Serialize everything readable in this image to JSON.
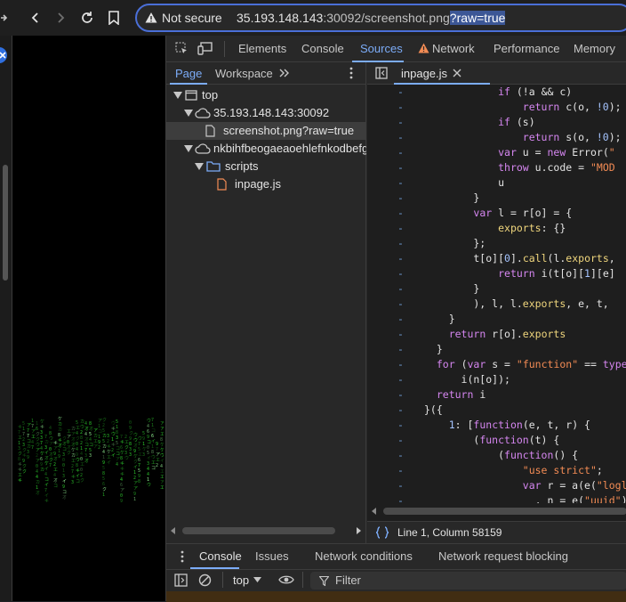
{
  "browser": {
    "security_label": "Not secure",
    "url_host": "35.193.148.143",
    "url_port_path": ":30092/screenshot.png",
    "url_query": "?raw=true"
  },
  "devtools": {
    "tabs": [
      {
        "label": "Elements"
      },
      {
        "label": "Console"
      },
      {
        "label": "Sources"
      },
      {
        "label": "Network"
      },
      {
        "label": "Performance"
      },
      {
        "label": "Memory"
      }
    ],
    "active_tab": "Sources",
    "navigator": {
      "tabs": [
        "Page",
        "Workspace"
      ],
      "tree": [
        {
          "label": "top"
        },
        {
          "label": "35.193.148.143:30092"
        },
        {
          "label": "screenshot.png?raw=true"
        },
        {
          "label": "nkbihfbeogaeaoehlefnkodbefgpgknn"
        },
        {
          "label": "scripts"
        },
        {
          "label": "inpage.js"
        }
      ]
    },
    "editor": {
      "file_tab": "inpage.js",
      "status": "Line 1, Column 58159",
      "gutter_marker": "-"
    },
    "drawer": {
      "tabs": [
        "Console",
        "Issues",
        "Network conditions",
        "Network request blocking"
      ],
      "context": "top",
      "filter_placeholder": "Filter"
    }
  },
  "colors": {
    "accent": "#7cacf8",
    "keyword": "#d586f0",
    "string": "#f28b54",
    "number": "#a5c4ff",
    "matrix_green": "#2fd12f"
  }
}
